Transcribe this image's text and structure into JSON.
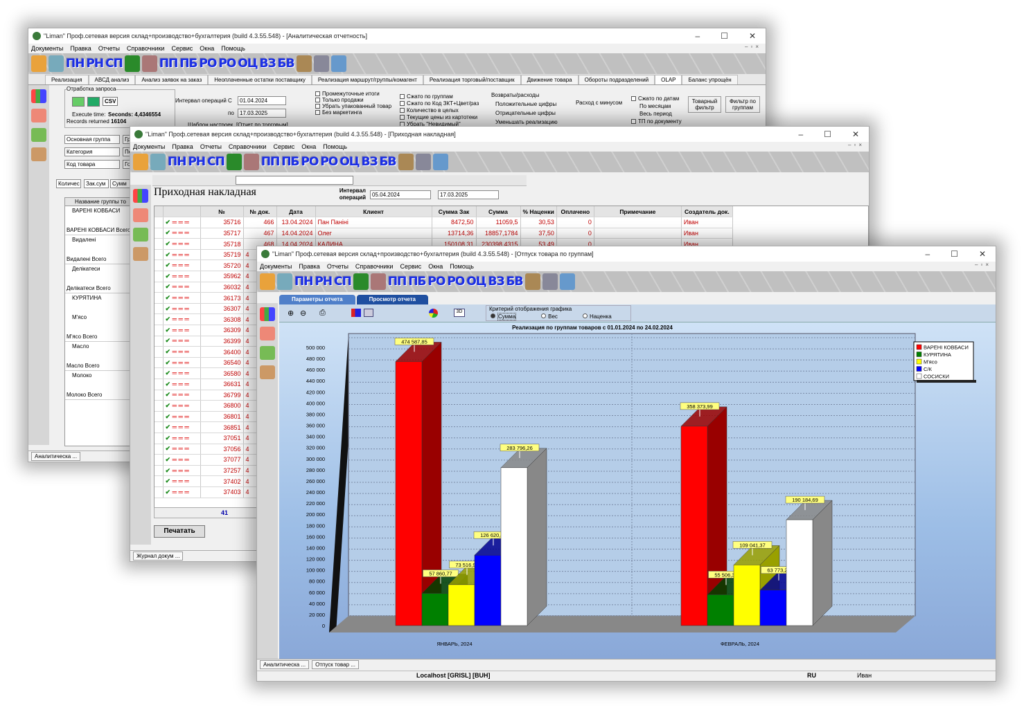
{
  "w1": {
    "title": "\"Liman\" Проф.сетевая версия склад+производство+бухгалтерия (build 4.3.55.548) - [Аналитическая отчетность]",
    "menu": [
      "Документы",
      "Правка",
      "Отчеты",
      "Справочники",
      "Сервис",
      "Окна",
      "Помощь"
    ],
    "toolbar": [
      "ПН",
      "РН",
      "СП",
      "ПП",
      "ПБ",
      "РО",
      "РО",
      "ОЦ",
      "ВЗ",
      "БВ"
    ],
    "tabs": [
      "Реализация",
      "АВСД анализ",
      "Анализ заявок на заказ",
      "Неоплаченные остатки поставщику",
      "Реализация маршрут/группы/комагент",
      "Реализация торговый/поставщик",
      "Движение товара",
      "Обороты подразделений",
      "OLAP",
      "Баланс упрощён"
    ],
    "req_group": "Отработка запроса",
    "csv": "CSV",
    "exec_label": "Execute time:",
    "exec_value": "Seconds: 4,4346554",
    "records_label": "Records returned",
    "records_value": "16104",
    "interval_label": "Интервал операций  С",
    "date_from": "01.04.2024",
    "to_label": "по",
    "date_to": "17.03.2025",
    "template_label": "Шаблон настроек",
    "template_value": "[Отчет по торговым]",
    "checks1": [
      "Промежуточные итоги",
      "Только продажи",
      "Убрать упакованный товар",
      "Без маркетинга"
    ],
    "checks2": [
      "Сжато по группам",
      "Сжато по Код ЗКТ+Цвет/раз",
      "Количество в целых",
      "Текущие цены из картотеки",
      "Убрать \"Невидимый\""
    ],
    "returns_label": "Возвраты/расходы",
    "returns": [
      "Положительные цифры",
      "Отрицательные цифры",
      "Уменьшать реализацию"
    ],
    "minus": "Расход с минусом",
    "dates_check": "Сжато по датам",
    "dates_opts": [
      "По месяцам",
      "Весь период"
    ],
    "tp_doc": "ТП по документу",
    "goods_filter": "Товарный фильтр",
    "group_filter": "Фильтр по группам",
    "pivot_fields": [
      "Основная группа",
      "Категория",
      "Код товара",
      "Количес",
      "Зак.сум",
      "Сумм"
    ],
    "pivot_fields2": [
      "Груп",
      "Подразде",
      "Год"
    ],
    "tree_header": "Название группы то",
    "tree": [
      "ВАРЕНІ КОВБАСИ",
      "ВАРЕНІ КОВБАСИ Всего",
      "Видалені",
      "Видалені Всего",
      "Делікатеси",
      "Делікатеси Всего",
      "КУРЯТИНА",
      "М'ясо",
      "М'ясо Всего",
      "Масло",
      "Масло Всего",
      "Молоко",
      "Молоко Всего"
    ],
    "status": "Аналитическа ..."
  },
  "w2": {
    "title": "\"Liman\" Проф.сетевая версия склад+производство+бухгалтерия (build 4.3.55.548) - [Приходная накладная]",
    "heading": "Приходная накладная",
    "interval_label": "Интервал операций",
    "date_from": "05.04.2024",
    "date_to": "17.03.2025",
    "columns": [
      "№",
      "№ док.",
      "Дата",
      "Клиент",
      "Сумма Зак",
      "Сумма",
      "% Наценки",
      "Оплачено",
      "Примечание",
      "Создатель док."
    ],
    "rows": [
      [
        "35716",
        "466",
        "13.04.2024",
        "Пан Паніні",
        "8472,50",
        "11059,5",
        "30,53",
        "0",
        "",
        "Иван"
      ],
      [
        "35717",
        "467",
        "14.04.2024",
        "Олег",
        "13714,36",
        "18857,1784",
        "37,50",
        "0",
        "",
        "Иван"
      ],
      [
        "35718",
        "468",
        "14.04.2024",
        "КАЛИНА",
        "150108,31",
        "230398,4315",
        "53,49",
        "0",
        "",
        "Иван"
      ]
    ],
    "more_nums": [
      "35719",
      "35720",
      "35962",
      "36032",
      "36173",
      "36307",
      "36308",
      "36309",
      "36399",
      "36400",
      "36540",
      "36580",
      "36631",
      "36799",
      "36800",
      "36801",
      "36851",
      "37051",
      "37056",
      "37077",
      "37257",
      "37402",
      "37403"
    ],
    "doc_digit": "4",
    "count": "41",
    "print": "Печатать",
    "status": "Журнал докум ..."
  },
  "w3": {
    "title": "\"Liman\" Проф.сетевая версия склад+производство+бухгалтерия (build 4.3.55.548) - [Отпуск товара по группам]",
    "tab_params": "Параметры отчета",
    "tab_view": "Просмотр отчета",
    "criteria_label": "Критерий отображения графика",
    "criteria": [
      "Сумма",
      "Вес",
      "Наценка"
    ],
    "status_tabs": [
      "Аналитическа ...",
      "Отпуск товар ..."
    ],
    "server": "Localhost [GRISL] [BUH]",
    "lang": "RU",
    "user": "Иван"
  },
  "chart_data": {
    "type": "bar",
    "title": "Реализация по группам товаров с 01.01.2024 по 24.02.2024",
    "categories": [
      "ЯНВАРЬ, 2024",
      "ФЕВРАЛЬ, 2024"
    ],
    "series": [
      {
        "name": "ВАРЕНІ КОВБАСИ",
        "color": "#ff0000",
        "values": [
          474587.85,
          358373.99
        ],
        "labels": [
          "474 587,85",
          "358 373,99"
        ]
      },
      {
        "name": "КУРЯТИНА",
        "color": "#008000",
        "values": [
          57860.77,
          55506.34
        ],
        "labels": [
          "57 860,77",
          "55 506,34"
        ]
      },
      {
        "name": "М'ясо",
        "color": "#ffff00",
        "values": [
          73516.97,
          109041.37
        ],
        "labels": [
          "73 516,97",
          "109 041,37"
        ]
      },
      {
        "name": "С/К",
        "color": "#0000ff",
        "values": [
          126620.42,
          63773.26
        ],
        "labels": [
          "126 620,42",
          "63 773,26"
        ]
      },
      {
        "name": "СОСИСКИ",
        "color": "#ffffff",
        "values": [
          283796.26,
          190184.69
        ],
        "labels": [
          "283 796,26",
          "190 184,69"
        ]
      }
    ],
    "ylim": [
      0,
      500000
    ],
    "ytick_step": 20000,
    "yticks": [
      "0",
      "20 000",
      "40 000",
      "60 000",
      "80 000",
      "100 000",
      "120 000",
      "140 000",
      "160 000",
      "180 000",
      "200 000",
      "220 000",
      "240 000",
      "260 000",
      "280 000",
      "300 000",
      "320 000",
      "340 000",
      "360 000",
      "380 000",
      "400 000",
      "420 000",
      "440 000",
      "460 000",
      "480 000",
      "500 000"
    ],
    "legend_position": "top-right",
    "grid": true
  }
}
